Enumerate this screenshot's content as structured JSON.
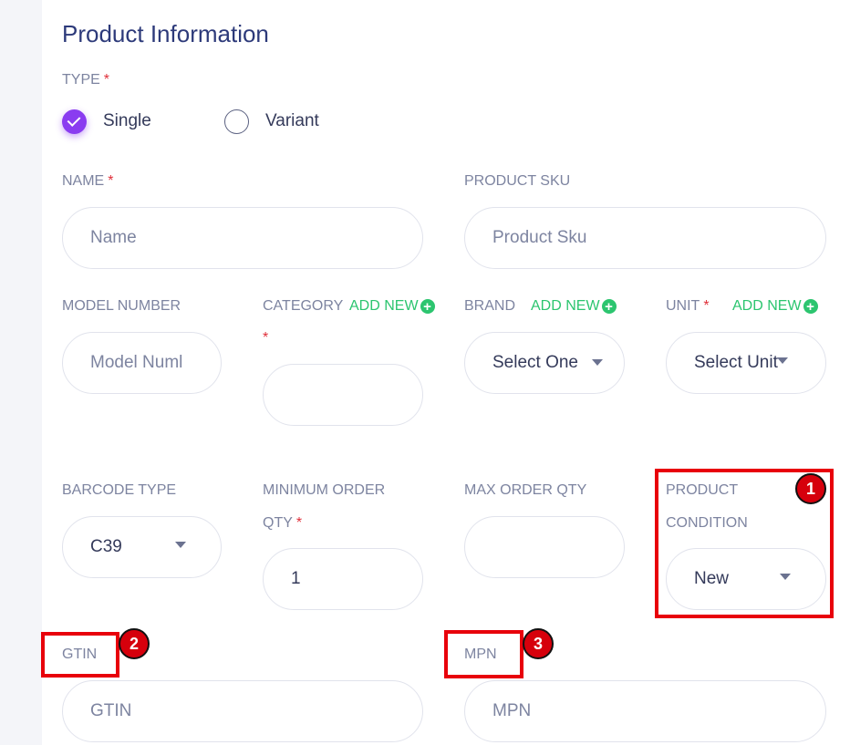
{
  "header": {
    "title": "Product Information"
  },
  "type": {
    "label": "TYPE",
    "required": "*",
    "options": [
      {
        "label": "Single",
        "selected": true
      },
      {
        "label": "Variant",
        "selected": false
      }
    ]
  },
  "name": {
    "label": "NAME",
    "required": "*",
    "placeholder": "Name"
  },
  "sku": {
    "label": "PRODUCT SKU",
    "placeholder": "Product Sku"
  },
  "model": {
    "label": "MODEL NUMBER",
    "placeholder": "Model Numl"
  },
  "category": {
    "label": "CATEGORY",
    "add_new": "ADD NEW",
    "required": "*"
  },
  "brand": {
    "label": "BRAND",
    "add_new": "ADD NEW",
    "selected": "Select One"
  },
  "unit": {
    "label": "UNIT",
    "required": "*",
    "add_new": "ADD NEW",
    "selected": "Select Unit"
  },
  "barcode": {
    "label": "BARCODE TYPE",
    "selected": "C39"
  },
  "min_order": {
    "label_line1": "MINIMUM ORDER",
    "label_line2": "QTY",
    "required": "*",
    "value": "1"
  },
  "max_order": {
    "label": "MAX ORDER QTY",
    "value": ""
  },
  "condition": {
    "label_line1": "PRODUCT",
    "label_line2": "CONDITION",
    "selected": "New"
  },
  "gtin": {
    "label": "GTIN",
    "placeholder": "GTIN"
  },
  "mpn": {
    "label": "MPN",
    "placeholder": "MPN"
  },
  "markers": [
    "1",
    "2",
    "3"
  ],
  "colors": {
    "accent": "#8a3cf0",
    "add_new": "#2cc56f",
    "required": "#e0303a",
    "highlight": "#e8000b",
    "title": "#2d3a7a"
  },
  "icons": {
    "checked_radio": "check-icon",
    "add_new": "plus-circle-icon",
    "dropdown": "caret-down-icon"
  }
}
